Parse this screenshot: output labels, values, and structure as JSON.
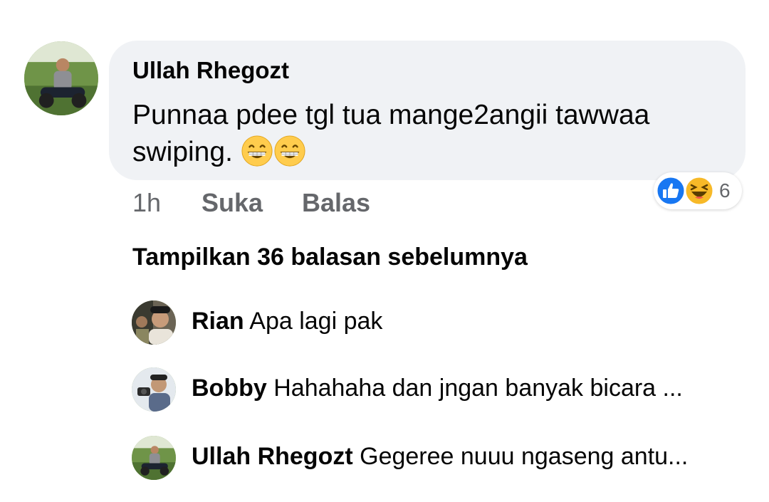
{
  "comment": {
    "author": "Ullah Rhegozt",
    "text": "Punnaa pdee tgl tua mange2angii tawwaa swiping. ",
    "emoji": [
      "grinning-face-icon",
      "grinning-face-icon"
    ],
    "time": "1h",
    "like_label": "Suka",
    "reply_label": "Balas",
    "reactions": {
      "icons": [
        "like-icon",
        "haha-icon"
      ],
      "count": "6"
    }
  },
  "replies": {
    "show_previous_label": "Tampilkan 36 balasan sebelumnya",
    "items": [
      {
        "name": "Rian",
        "text": "Apa lagi pak"
      },
      {
        "name": "Bobby",
        "text": "Hahahaha dan jngan banyak bicara ..."
      },
      {
        "name": "Ullah Rhegozt",
        "text": "Gegeree nuuu ngaseng antu..."
      }
    ]
  },
  "colors": {
    "bubble": "#f0f2f5",
    "secondary_text": "#65676b",
    "like_blue": "#1877f2",
    "haha_yellow": "#f7b928"
  }
}
